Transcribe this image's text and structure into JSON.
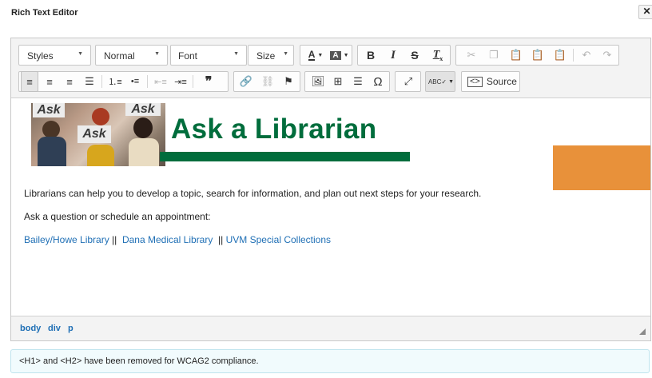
{
  "dialog": {
    "title": "Rich Text Editor",
    "close_glyph": "✕"
  },
  "toolbar": {
    "styles_label": "Styles",
    "format_label": "Normal",
    "font_label": "Font",
    "size_label": "Size",
    "source_label": "Source",
    "icons_row1": [
      "text-color-icon",
      "background-color-icon",
      "bold-icon",
      "italic-icon",
      "strikethrough-icon",
      "remove-format-icon",
      "cut-icon",
      "copy-icon",
      "paste-icon",
      "paste-text-icon",
      "paste-word-icon",
      "undo-icon",
      "redo-icon"
    ],
    "icons_row2": [
      "align-left-icon",
      "align-center-icon",
      "align-right-icon",
      "justify-icon",
      "numbered-list-icon",
      "bulleted-list-icon",
      "decrease-indent-icon",
      "increase-indent-icon",
      "blockquote-icon",
      "link-icon",
      "unlink-icon",
      "anchor-icon",
      "image-icon",
      "table-icon",
      "horizontal-line-icon",
      "special-char-icon",
      "maximize-icon",
      "spellcheck-icon",
      "source-icon"
    ]
  },
  "content": {
    "banner_title": "Ask a Librarian",
    "photo_sign_1": "Ask",
    "photo_sign_2": "Ask",
    "photo_sign_3": "Ask",
    "paragraph_1": "Librarians can help you to develop a topic, search for information, and plan out next steps for your research.",
    "paragraph_2": "Ask a question or schedule an appointment:",
    "links": [
      {
        "label": "Bailey/Howe Library"
      },
      {
        "label": "Dana Medical Library"
      },
      {
        "label": "UVM Special Collections"
      }
    ],
    "link_separator": " ||",
    "colors": {
      "brand_green": "#006d3c",
      "accent_orange": "#e8913a",
      "link_blue": "#1f6fb5"
    }
  },
  "statusbar": {
    "path": [
      "body",
      "div",
      "p"
    ]
  },
  "notice": {
    "text": "<H1> and <H2> have been removed for WCAG2 compliance."
  }
}
